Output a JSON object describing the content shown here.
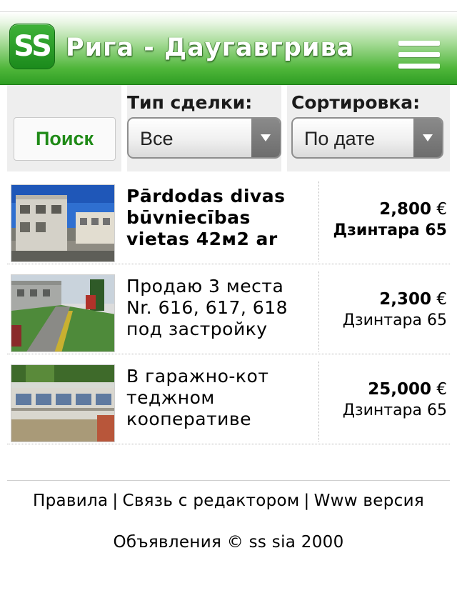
{
  "header": {
    "logo_text": "SS",
    "title": "Рига - Даугавгрива",
    "menu_icon": "hamburger-menu-icon"
  },
  "filters": {
    "search_label": "Поиск",
    "deal_type_label": "Тип сделки:",
    "deal_type_value": "Все",
    "sort_label": "Сортировка:",
    "sort_value": "По дате"
  },
  "listings": [
    {
      "title": "Pārdodas divas būvniecības vietas 42м2 ar",
      "price": "2,800",
      "currency": "€",
      "street": "Дзинтара 65",
      "highlight": true
    },
    {
      "title": "Продаю 3 места Nr. 616, 617, 618 под застройку",
      "price": "2,300",
      "currency": "€",
      "street": "Дзинтара 65",
      "highlight": false
    },
    {
      "title": "В гаражно-кот теджном кооперативе",
      "price": "25,000",
      "currency": "€",
      "street": "Дзинтара 65",
      "highlight": false
    }
  ],
  "footer": {
    "rules": "Правила",
    "contact": "Связь с редактором",
    "www": "Www версия",
    "separator": "|",
    "copyright": "Объявления © ss sia 2000"
  },
  "colors": {
    "header_green": "#2f9e24",
    "search_text_green": "#1f8a17"
  }
}
